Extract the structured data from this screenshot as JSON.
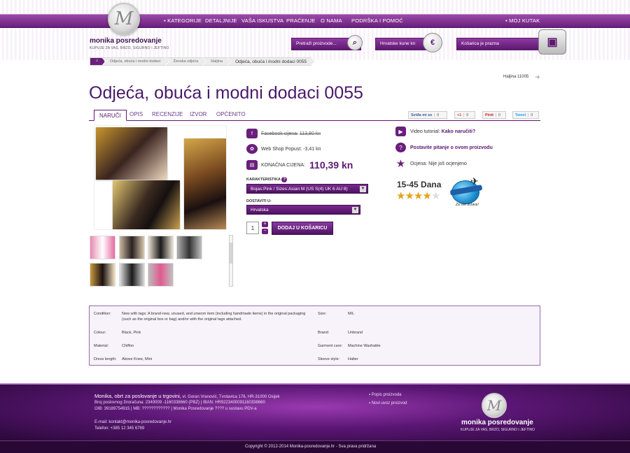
{
  "nav": {
    "items": [
      "▪ KATEGORIJE",
      "DETALJNIJE",
      "VAŠA ISKUSTVA",
      "PRAĆENJE",
      "O NAMA",
      "PODRŠKA I POMOĆ"
    ],
    "right": "▪ MOJ KUTAK"
  },
  "brand": {
    "logo_letter": "M",
    "name": "monika posredovanje",
    "tagline": "KUPUJE ZA VAS, BRZO, SIGURNO I JEFTINO"
  },
  "header": {
    "search_placeholder": "Pretraži proizvode...",
    "currency": "Hrvatske kune kn",
    "cart": "Košarica je prazna"
  },
  "breadcrumb": [
    "Odjeća, obuća i modni dodaci",
    "Ženska odjeća",
    "Haljina",
    "Odjeća, obuća i modni dodaci 0055"
  ],
  "item_no": "Haljina 11005",
  "title": "Odjeća, obuća i modni dodaci 0055",
  "tabs": [
    "NARUČI",
    "OPIS",
    "RECENZIJE",
    "IZVOR",
    "OPĆENITO"
  ],
  "share": [
    {
      "label": "Sviđa mi se",
      "count": "0"
    },
    {
      "label": "+1",
      "count": "0"
    },
    {
      "label": "Pinit",
      "count": "0"
    },
    {
      "label": "Tweet",
      "count": "0"
    }
  ],
  "price": {
    "facebook_label": "Facebook cijena:",
    "facebook_value": "113,80 kn",
    "discount_label": "Web Shop Popust:",
    "discount_value": "-3,41 kn",
    "final_label": "KONAČNA CIJENA:",
    "final_value": "110,39 kn"
  },
  "options": {
    "attr_label": "KARAKTERISTIKA",
    "attr_value": "Bojas:Pink / Sizes:Asian M (US S(4) UK 6 AU 8)",
    "ship_label": "DOSTAVITI U:",
    "ship_value": "Hrvatska",
    "qty": "1",
    "add_button": "DODAJ U KOŠARICU"
  },
  "right": {
    "video_label": "Video tutorial:",
    "video_link": "Kako naručiti?",
    "ask_link": "Postavite pitanje o ovom proizvodu",
    "rating_label": "Ocjena:",
    "rating_value": "Nije još ocjenjeno",
    "delivery": "15-45 Dana",
    "stars_filled": 4,
    "stars_total": 5,
    "shipping_badge": "Za sve države!"
  },
  "specs": {
    "condition_label": "Condition:",
    "condition_value": "New with tags: A brand-new, unused, and unworn item (including handmade items) in the original packaging (such as the original box or bag) and/or with the original tags attached.",
    "size_label": "Size:",
    "size_value": "M/L",
    "colour_label": "Colour:",
    "colour_value": "Black, Pink",
    "brand_label": "Brand:",
    "brand_value": "Unbrand",
    "material_label": "Material:",
    "material_value": "Chiffon",
    "care_label": "Garment care:",
    "care_value": "Machine Washable",
    "length_label": "Dress length:",
    "length_value": "Above Knee, Mini",
    "sleeve_label": "Sleeve style:",
    "sleeve_value": "Halter"
  },
  "footer": {
    "company": "Monika, obrt za poslovanje u trgovini,",
    "address": "vl. Goran Vranović, Tvrdavica 176, HR-31000 Osijek",
    "account": "Broj poslovnog žiroračuna: 2340009 -1160338660 (PBZ)  |  IBAN: HR9223400091160338660",
    "oib": "OIB: 39189754915  |  MB: ????????????  |  Monika Posredovanje ???? u sustavu PDV-a",
    "email": "E-mail: kontakt@monika-posredovanje.hr",
    "phone": "Telefon: +385 12 345 6789",
    "links": [
      "Popis proizvoda",
      "Novi uvoz proizvod"
    ],
    "copyright": "Copyright © 2012-2014 Monika-posredovanje.hr - Sva prava pridržana"
  }
}
